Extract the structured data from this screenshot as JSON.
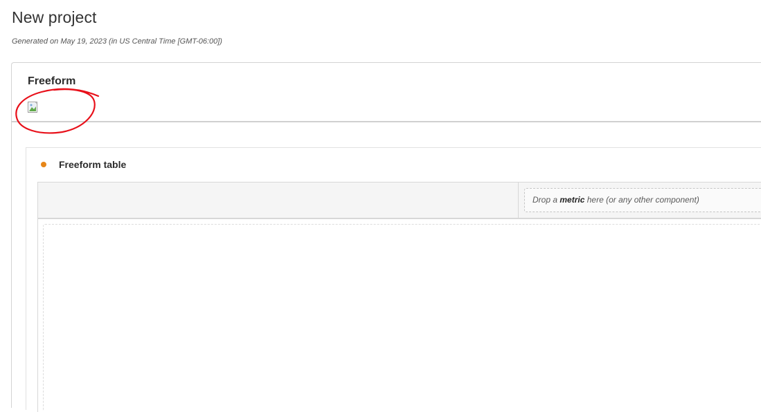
{
  "project": {
    "title": "New project",
    "generated": "Generated on May 19, 2023 (in US Central Time [GMT-06:00])"
  },
  "panel": {
    "title": "Freeform",
    "image": "broken-image-icon"
  },
  "visualization": {
    "title": "Freeform table",
    "status_color": "#e68619",
    "metric_drop_prefix": "Drop a ",
    "metric_drop_keyword": "metric",
    "metric_drop_suffix": " here (or any other component)"
  },
  "colors": {
    "annotation": "#e8101a",
    "status_dot": "#e68619"
  }
}
